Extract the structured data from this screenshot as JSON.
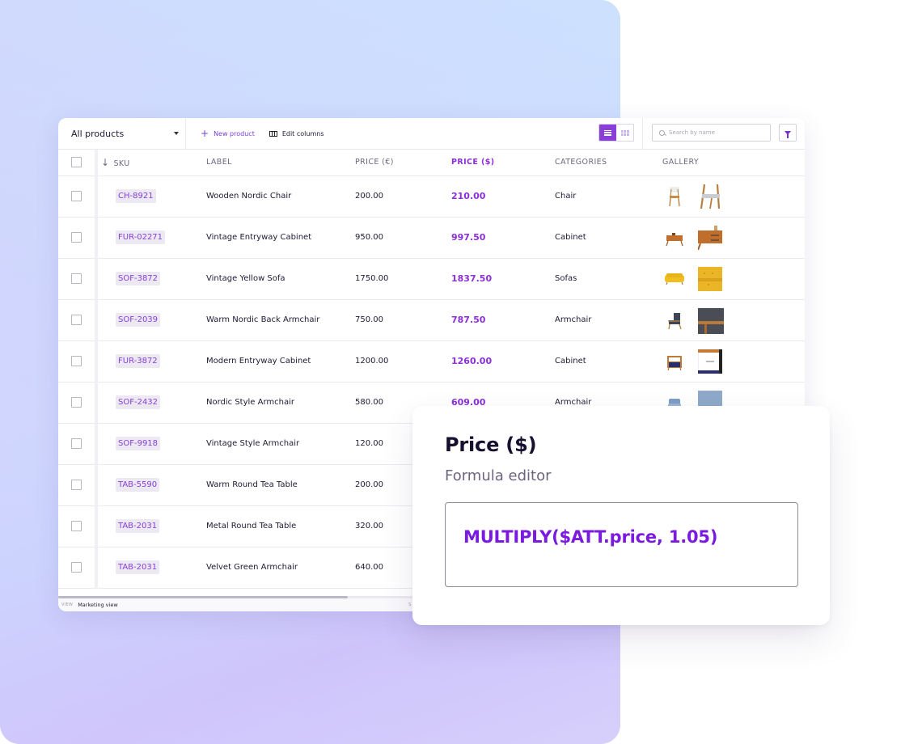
{
  "toolbar": {
    "view_selector": "All products",
    "new_product_label": "New product",
    "edit_columns_label": "Edit columns",
    "search_placeholder": "Search by name",
    "view_mode": "list"
  },
  "table": {
    "columns": [
      "SKU",
      "LABEL",
      "PRICE (€)",
      "PRICE ($)",
      "CATEGORIES",
      "GALLERY"
    ],
    "highlighted_column": "PRICE ($)",
    "sort": {
      "column": "SKU",
      "direction": "descending"
    },
    "rows": [
      {
        "sku": "CH-8921",
        "label": "Wooden Nordic Chair",
        "price_eur": "200.00",
        "price_usd": "210.00",
        "category": "Chair",
        "gallery": [
          "chair-thumbnail",
          "chair-detail-thumbnail"
        ]
      },
      {
        "sku": "FUR-02271",
        "label": "Vintage Entryway Cabinet",
        "price_eur": "950.00",
        "price_usd": "997.50",
        "category": "Cabinet",
        "gallery": [
          "cabinet-thumbnail",
          "cabinet-detail-thumbnail"
        ]
      },
      {
        "sku": "SOF-3872",
        "label": "Vintage Yellow Sofa",
        "price_eur": "1750.00",
        "price_usd": "1837.50",
        "category": "Sofas",
        "gallery": [
          "sofa-thumbnail",
          "sofa-fabric-thumbnail"
        ]
      },
      {
        "sku": "SOF-2039",
        "label": "Warm Nordic Back Armchair",
        "price_eur": "750.00",
        "price_usd": "787.50",
        "category": "Armchair",
        "gallery": [
          "armchair-thumbnail",
          "armchair-detail-thumbnail"
        ]
      },
      {
        "sku": "FUR-3872",
        "label": "Modern Entryway Cabinet",
        "price_eur": "1200.00",
        "price_usd": "1260.00",
        "category": "Cabinet",
        "gallery": [
          "cabinet-thumbnail",
          "cabinet-detail-thumbnail"
        ]
      },
      {
        "sku": "SOF-2432",
        "label": "Nordic Style Armchair",
        "price_eur": "580.00",
        "price_usd": "609.00",
        "category": "Armchair",
        "gallery": [
          "armchair-thumbnail",
          "armchair-fabric-thumbnail"
        ]
      },
      {
        "sku": "SOF-9918",
        "label": "Vintage Style Armchair",
        "price_eur": "120.00",
        "price_usd": "",
        "category": "",
        "gallery": []
      },
      {
        "sku": "TAB-5590",
        "label": "Warm Round Tea Table",
        "price_eur": "200.00",
        "price_usd": "",
        "category": "",
        "gallery": []
      },
      {
        "sku": "TAB-2031",
        "label": "Metal Round Tea Table",
        "price_eur": "320.00",
        "price_usd": "",
        "category": "",
        "gallery": []
      },
      {
        "sku": "TAB-2031",
        "label": "Velvet Green Armchair",
        "price_eur": "640.00",
        "price_usd": "",
        "category": "",
        "gallery": []
      }
    ]
  },
  "footer": {
    "view_label": "VIEW",
    "view_value": "Marketing view",
    "extra": "S"
  },
  "formula_editor": {
    "title": "Price ($)",
    "subtitle": "Formula editor",
    "formula": "MULTIPLY($ATT.price, 1.05)"
  },
  "colors": {
    "accent": "#8b2fd9",
    "formula_text": "#7a1adf",
    "sku_tag_bg": "#ede9f3"
  }
}
